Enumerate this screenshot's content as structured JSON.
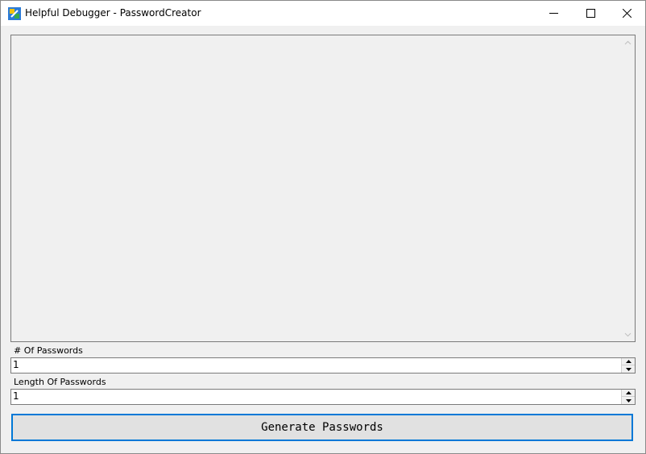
{
  "window": {
    "title": "Helpful Debugger - PasswordCreator",
    "icon": "app-icon"
  },
  "output": {
    "text": ""
  },
  "fields": {
    "count_label": "# Of Passwords",
    "count_value": "1",
    "length_label": "Length Of Passwords",
    "length_value": "1"
  },
  "actions": {
    "generate_label": "Generate Passwords"
  },
  "colors": {
    "accent": "#0078d7",
    "window_bg": "#f0f0f0",
    "titlebar_bg": "#ffffff"
  }
}
